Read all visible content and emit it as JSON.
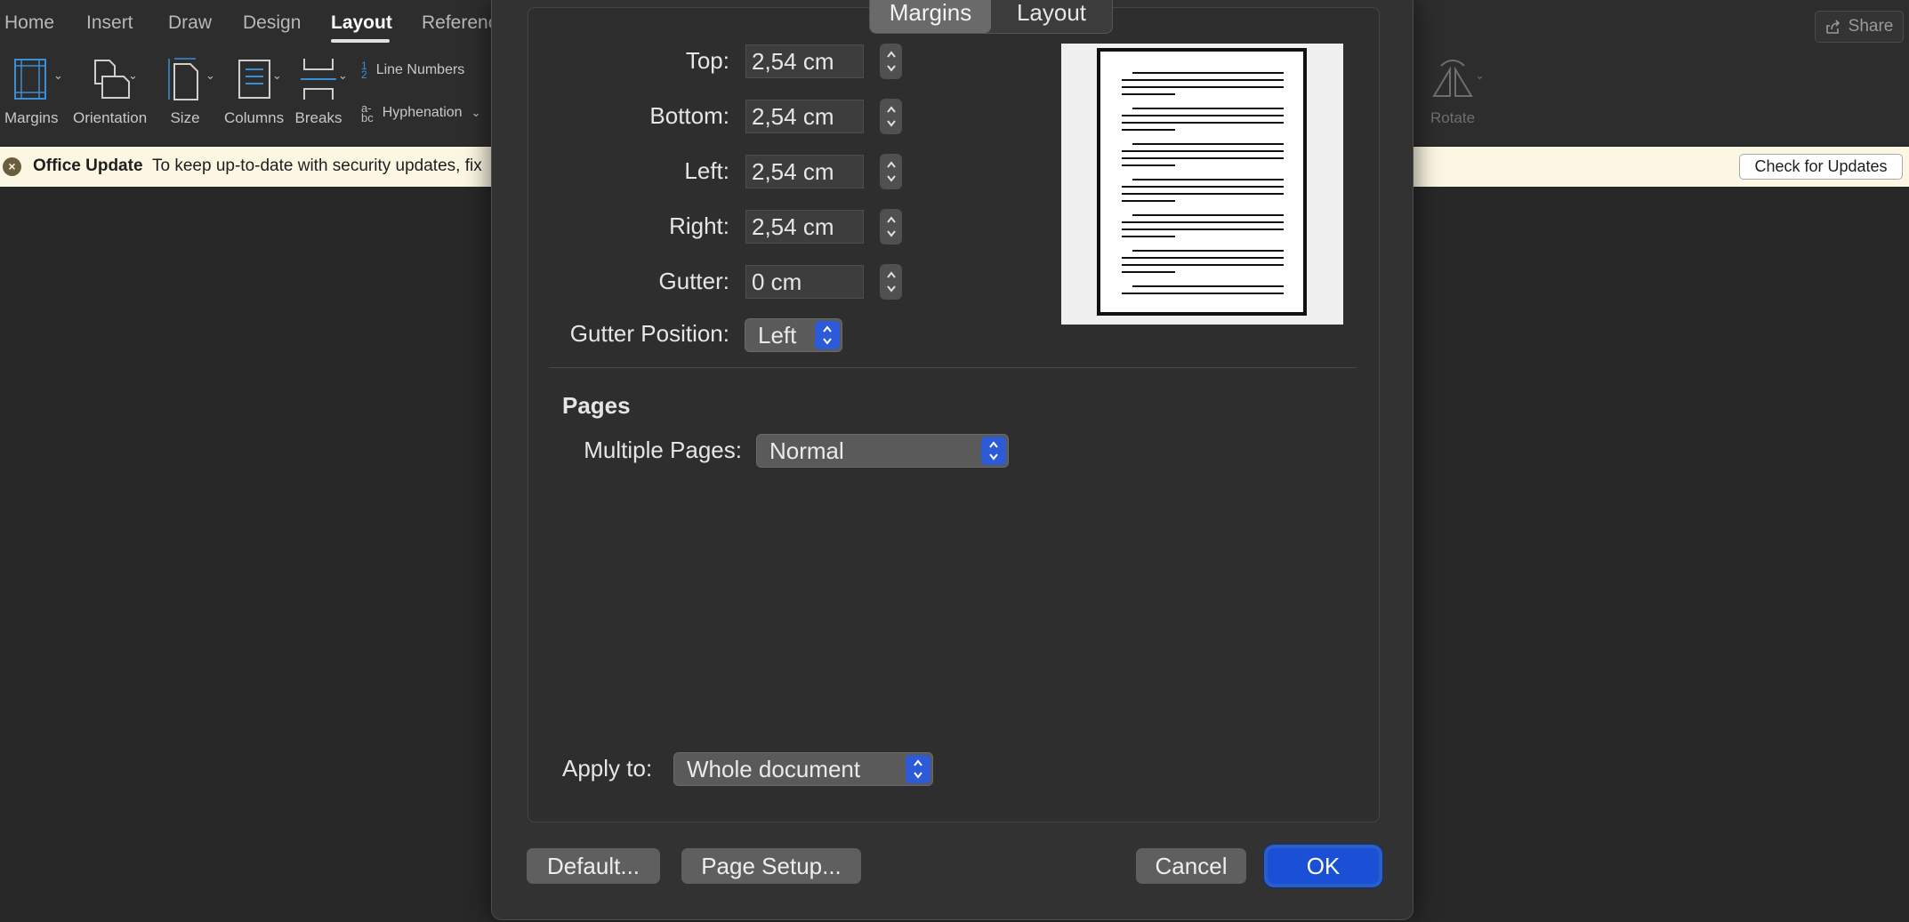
{
  "ribbon": {
    "tabs": [
      "Home",
      "Insert",
      "Draw",
      "Design",
      "Layout",
      "Referenc"
    ],
    "share_label": "Share",
    "tools": {
      "margins": "Margins",
      "orientation": "Orientation",
      "size": "Size",
      "columns": "Columns",
      "breaks": "Breaks",
      "line_numbers": "Line Numbers",
      "hyphenation": "Hyphenation",
      "rotate": "Rotate"
    }
  },
  "update_bar": {
    "title": "Office Update",
    "message": "To keep up-to-date with security updates, fix",
    "button": "Check for Updates"
  },
  "dialog": {
    "tabs": {
      "margins": "Margins",
      "layout": "Layout"
    },
    "fields": {
      "top": {
        "label": "Top:",
        "value": "2,54 cm"
      },
      "bottom": {
        "label": "Bottom:",
        "value": "2,54 cm"
      },
      "left": {
        "label": "Left:",
        "value": "2,54 cm"
      },
      "right": {
        "label": "Right:",
        "value": "2,54 cm"
      },
      "gutter": {
        "label": "Gutter:",
        "value": "0 cm"
      }
    },
    "gutter_position": {
      "label": "Gutter Position:",
      "value": "Left"
    },
    "pages": {
      "title": "Pages",
      "multiple_label": "Multiple Pages:",
      "multiple_value": "Normal"
    },
    "apply_to": {
      "label": "Apply to:",
      "value": "Whole document"
    },
    "buttons": {
      "default": "Default...",
      "page_setup": "Page Setup...",
      "cancel": "Cancel",
      "ok": "OK"
    }
  }
}
